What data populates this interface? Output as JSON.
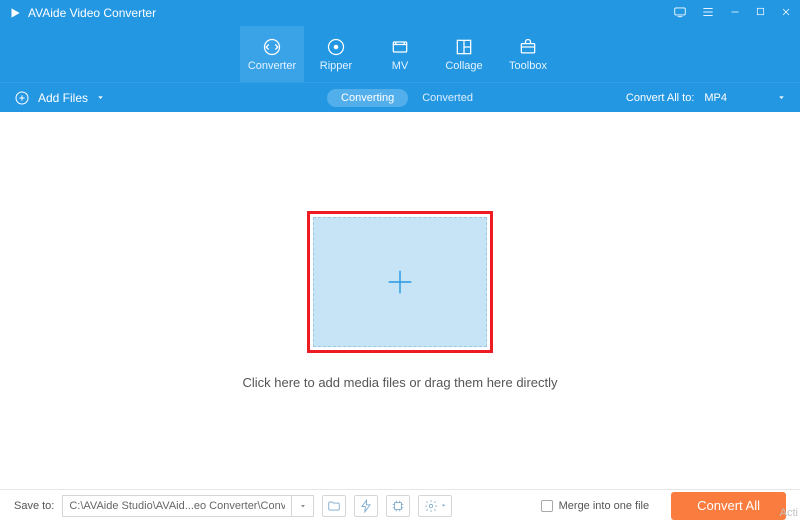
{
  "titlebar": {
    "app_name": "AVAide Video Converter"
  },
  "nav": {
    "items": [
      {
        "label": "Converter"
      },
      {
        "label": "Ripper"
      },
      {
        "label": "MV"
      },
      {
        "label": "Collage"
      },
      {
        "label": "Toolbox"
      }
    ]
  },
  "toolbar": {
    "add_files": "Add Files",
    "tabs": {
      "converting": "Converting",
      "converted": "Converted"
    },
    "convert_all_to_label": "Convert All to:",
    "format": "MP4"
  },
  "main": {
    "drop_hint": "Click here to add media files or drag them here directly"
  },
  "footer": {
    "save_to_label": "Save to:",
    "save_path": "C:\\AVAide Studio\\AVAid...eo Converter\\Converted",
    "merge_label": "Merge into one file",
    "convert_button": "Convert All"
  },
  "watermark": "Acti"
}
